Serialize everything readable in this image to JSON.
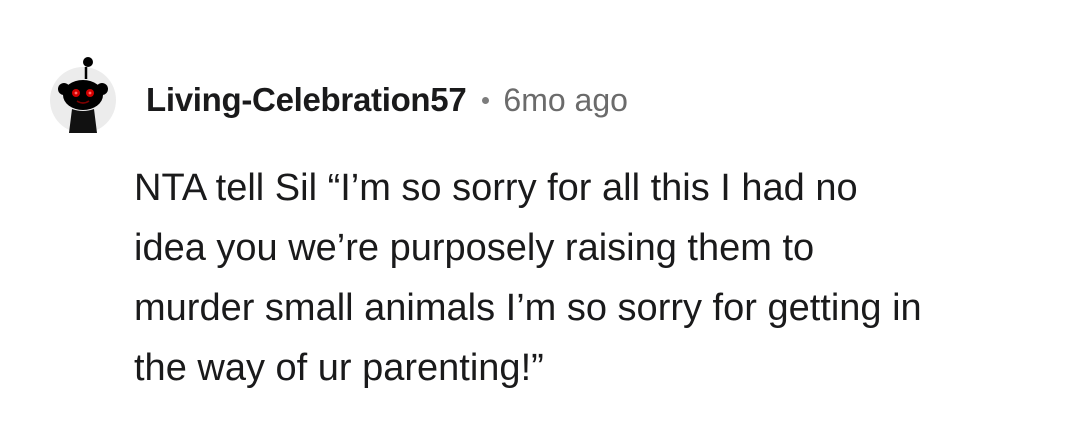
{
  "comment": {
    "author": "Living-Celebration57",
    "separator": "•",
    "timestamp": "6mo ago",
    "lines": [
      "NTA tell Sil “I’m so sorry for all this I had no",
      "idea you we’re purposely raising them to",
      "murder small animals I’m so sorry for getting in",
      "the way of ur parenting!”"
    ],
    "avatar_icon": "snoo-avatar-icon"
  },
  "colors": {
    "text": "#1a1a1b",
    "meta": "#6b6b6b",
    "avatar_bg": "#ececec",
    "avatar_eye": "#d40000"
  }
}
